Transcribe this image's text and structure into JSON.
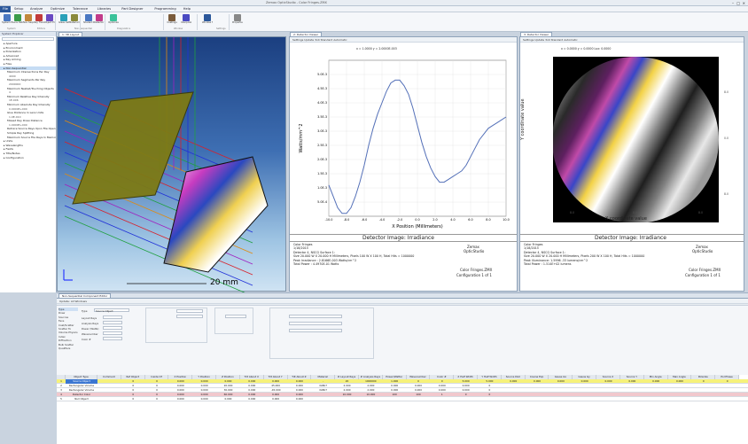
{
  "window": {
    "title": "Zemax OpticStudio - Color Fringes.ZMX"
  },
  "menu": [
    "File",
    "Setup",
    "Analyze",
    "Optimize",
    "Tolerance",
    "Libraries",
    "Part Designer",
    "Programming",
    "Help"
  ],
  "ribbon": {
    "buttons": [
      "System Explorer",
      "Lens Data",
      "Non-Sequential",
      "Ray Trace",
      "Object Editor",
      "Glass Catalogs",
      "Material Info",
      "Shaded Model",
      "Detector Viewer",
      "Optimize",
      "Coatings",
      "Interpolate",
      "Window Settings",
      "Properties"
    ],
    "groups": [
      "System",
      "Editors",
      "Non-Sequential",
      "Diagnostics",
      "Window",
      "Settings"
    ]
  },
  "sidebar": {
    "header": "System Explorer",
    "items": [
      {
        "label": "Aperture",
        "kind": "item"
      },
      {
        "label": "Environment",
        "kind": "item"
      },
      {
        "label": "Polarization",
        "kind": "item"
      },
      {
        "label": "Advanced",
        "kind": "item"
      },
      {
        "label": "Ray Aiming",
        "kind": "item"
      },
      {
        "label": "Files",
        "kind": "item"
      },
      {
        "label": "Non-Sequential",
        "kind": "sel"
      },
      {
        "label": "Maximum Intersections Per Ray",
        "kind": "sub"
      },
      {
        "label": "4000",
        "kind": "box"
      },
      {
        "label": "Maximum Segments Per Ray",
        "kind": "sub"
      },
      {
        "label": "2000000",
        "kind": "box"
      },
      {
        "label": "Maximum Nested/Touching Objects",
        "kind": "sub"
      },
      {
        "label": "4",
        "kind": "box"
      },
      {
        "label": "Minimum Relative Ray Intensity",
        "kind": "sub"
      },
      {
        "label": "1E-006",
        "kind": "box"
      },
      {
        "label": "Minimum Absolute Ray Intensity",
        "kind": "sub"
      },
      {
        "label": "0.0000E+000",
        "kind": "box"
      },
      {
        "label": "Glue Distance In Lens Units",
        "kind": "sub"
      },
      {
        "label": "1.0E-010",
        "kind": "box"
      },
      {
        "label": "Missed Ray Draw Distance",
        "kind": "sub"
      },
      {
        "label": "1.0000E+000",
        "kind": "box"
      },
      {
        "label": "Retrace Source Rays Upon File Open",
        "kind": "sub"
      },
      {
        "label": "Simple Ray Splitting",
        "kind": "sub"
      },
      {
        "label": "Maximum Source File Rays In Memory",
        "kind": "sub"
      },
      {
        "label": "Units",
        "kind": "item"
      },
      {
        "label": "Wavelengths",
        "kind": "item"
      },
      {
        "label": "Fields",
        "kind": "item"
      },
      {
        "label": "Title/Notes",
        "kind": "item"
      },
      {
        "label": "Configuration",
        "kind": "item"
      }
    ]
  },
  "layout3d": {
    "tab": "1: 3D Layout",
    "scale_label": "20 mm"
  },
  "irradiance": {
    "tab": "2: Detector Viewer",
    "toolbar": "Settings  Update  3x4  Standard  Automatic",
    "plot_header": "x = 1.0000  y = 2.0000E-003",
    "detector_title": "Detector Image: Irradiance",
    "info": [
      "Color Fringes",
      "1/18/2015",
      "Detector 4, NSCG Surface 1:",
      "Size 20.000 W X 20.000 H Millimeters, Pixels 100 W X 100 H, Total Hits = 1000000",
      "Peak Irradiance : 2.8166E-003 Watts/cm^2",
      "Total Power     : 4.4970E-01 Watts"
    ],
    "brand": [
      "Zemax",
      "OpticStudio"
    ],
    "file": "Color Fringes.ZMX",
    "config": "Configuration 1 of 1"
  },
  "truecolor": {
    "tab": "3: Detector Viewer",
    "toolbar": "Settings  Update  3x4  Standard  Automatic",
    "plot_header": "x = 0.0000  y = 0.0000  Lux: 0.0000",
    "detector_title": "Detector Image: Irradiance",
    "xlabel": "X coordinate value",
    "ylabel": "Y coordinate value",
    "ticks_x": [
      "8.0",
      "0.0",
      "8.0"
    ],
    "ticks_y": [
      "8.0",
      "0.0",
      "8.0"
    ],
    "info": [
      "Color Fringes",
      "1/18/2015",
      "Detector 4, NSCG Surface 1:",
      "Size 20.000 W X 20.000 H Millimeters, Pixels 200 W X 100 H, Total Hits = 1000000",
      "Peak Illuminance: 1.5996 -33 lumens/cm^2",
      "Total Power     : 1.514E+02 lumens"
    ],
    "brand": [
      "Zemax",
      "OpticStudio"
    ],
    "file": "Color Fringes.ZMX",
    "config": "Configuration 1 of 1"
  },
  "chart_data": {
    "type": "line",
    "title": "",
    "xlabel": "X Position (Millimeters)",
    "ylabel": "Watts/mm^2",
    "xlim": [
      -10,
      10
    ],
    "ylim": [
      0,
      0.0055
    ],
    "xticks": [
      "-10.0",
      "-8.0",
      "-6.0",
      "-4.0",
      "-2.0",
      "0.0",
      "2.0",
      "4.0",
      "6.0",
      "8.0",
      "10.0"
    ],
    "yticks": [
      "5.0E-4",
      "1.0E-3",
      "1.5E-3",
      "2.0E-3",
      "2.5E-3",
      "3.0E-3",
      "3.5E-3",
      "4.0E-3",
      "4.5E-3",
      "5.0E-3"
    ],
    "x": [
      -10,
      -9.5,
      -9,
      -8.5,
      -8,
      -7.5,
      -7,
      -6.5,
      -6,
      -5.5,
      -5,
      -4.5,
      -4,
      -3.5,
      -3,
      -2.5,
      -2,
      -1.5,
      -1,
      -0.5,
      0,
      0.5,
      1,
      1.5,
      2,
      2.5,
      3,
      3.5,
      4,
      4.5,
      5,
      5.5,
      6,
      6.5,
      7,
      7.5,
      8,
      8.5,
      9,
      9.5,
      10
    ],
    "y": [
      0.0011,
      0.0007,
      0.0003,
      0.0001,
      0.0001,
      0.0003,
      0.0007,
      0.0012,
      0.0018,
      0.0025,
      0.0031,
      0.0036,
      0.004,
      0.0044,
      0.0047,
      0.0048,
      0.0048,
      0.0046,
      0.0043,
      0.0038,
      0.0032,
      0.0026,
      0.0021,
      0.0017,
      0.0014,
      0.0012,
      0.0012,
      0.0013,
      0.0014,
      0.0015,
      0.0016,
      0.0018,
      0.0021,
      0.0024,
      0.0027,
      0.0029,
      0.0031,
      0.0032,
      0.0033,
      0.0034,
      0.0035
    ],
    "color": "#5470b8"
  },
  "object_editor": {
    "tab": "Non-Sequential Component Editor",
    "toolbar": "Update: All Windows",
    "headers": [
      "Object Type",
      "Comment",
      "Ref Object",
      "Inside Of",
      "X Position",
      "Y Position",
      "Z Position",
      "Tilt About X",
      "Tilt About Y",
      "Tilt About Z",
      "Material",
      "# Layout Rays",
      "# Analysis Rays",
      "Power(Watts)",
      "Wavenumber",
      "Color #",
      "X Half Width",
      "Y Half Width",
      "Source Dist",
      "Cosine Exp",
      "Gauss Gx",
      "Gauss Gy",
      "Source X",
      "Source Y",
      "Min Angle",
      "Max Angle",
      "Polarize",
      "Pol Phase"
    ],
    "rows": [
      {
        "num": "1",
        "cells": [
          "Source Object",
          "",
          "0",
          "0",
          "0.000",
          "0.000",
          "0.000",
          "0.000",
          "0.000",
          "0.000",
          "-",
          "20",
          "1000000",
          "1.000",
          "0",
          "0",
          "5.000",
          "5.000",
          "0.000",
          "0.000",
          "0.000",
          "0.000",
          "0.000",
          "0.000",
          "0.000",
          "0.000",
          "0",
          "0"
        ]
      },
      {
        "num": "2",
        "cells": [
          "Rectangular Volume",
          "",
          "0",
          "0",
          "0.000",
          "0.000",
          "20.000",
          "0.000",
          "45.000",
          "0.000",
          "N-BK7",
          "2.000",
          "2.000",
          "0.000",
          "0.000",
          "0.000",
          "0.000",
          "0",
          "",
          "",
          "",
          "",
          "",
          "",
          "",
          "",
          "",
          ""
        ]
      },
      {
        "num": "3",
        "cells": [
          "Rectangular Volume",
          "",
          "0",
          "0",
          "0.000",
          "0.000",
          "30.000",
          "0.000",
          "-45.000",
          "0.000",
          "N-BK7",
          "2.000",
          "2.000",
          "0.000",
          "0.000",
          "0.000",
          "0.000",
          "0",
          "",
          "",
          "",
          "",
          "",
          "",
          "",
          "",
          "",
          ""
        ]
      },
      {
        "num": "4",
        "cells": [
          "Detector Color",
          "",
          "0",
          "0",
          "0.000",
          "0.000",
          "60.000",
          "0.000",
          "0.000",
          "0.000",
          "",
          "10.000",
          "10.000",
          "100",
          "100",
          "1",
          "0",
          "0",
          "",
          "",
          "",
          "",
          "",
          "",
          "",
          "",
          "",
          ""
        ]
      },
      {
        "num": "5",
        "cells": [
          "Null Object",
          "",
          "0",
          "0",
          "0.000",
          "0.000",
          "0.000",
          "0.000",
          "0.000",
          "0.000",
          "",
          "",
          "",
          "",
          "",
          "",
          "",
          "",
          "",
          "",
          "",
          "",
          "",
          "",
          "",
          "",
          "",
          ""
        ]
      }
    ]
  },
  "object_props": {
    "sections": [
      "Type",
      "Draw",
      "Sources",
      "Face",
      "Coat/Scatter",
      "Scatter To",
      "Volume Physics",
      "Index",
      "Diffraction",
      "Bulk Scatter",
      "Qualifiers"
    ],
    "type_label": "Type",
    "type_value": "Source Object",
    "labels": [
      "Layout Rays",
      "Analysis Rays",
      "Power (Watts)",
      "Wavenumber",
      "Color #"
    ]
  },
  "colors": {
    "accent": "#2b579a",
    "row_selected": "#f6f27a",
    "row_detector": "#f1c8cd"
  }
}
